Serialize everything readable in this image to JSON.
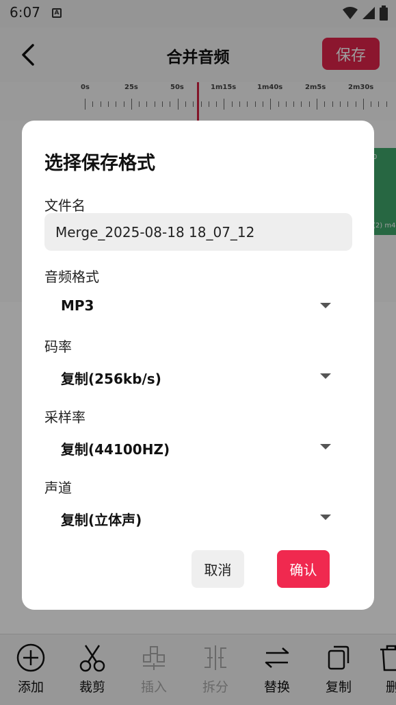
{
  "status_bar": {
    "time": "6:07",
    "notification_icon": "A"
  },
  "header": {
    "title": "合并音频",
    "save_label": "保存"
  },
  "timeline": {
    "ticks": [
      "0s",
      "25s",
      "50s",
      "1m15s",
      "1m40s",
      "2m5s",
      "2m30s"
    ]
  },
  "track": {
    "label_top": "0",
    "label_bottom": "(2) m4"
  },
  "dialog": {
    "title": "选择保存格式",
    "filename_label": "文件名",
    "filename_value": "Merge_2025-08-18 18_07_12",
    "format_label": "音频格式",
    "format_value": "MP3",
    "bitrate_label": "码率",
    "bitrate_value": "复制(256kb/s)",
    "samplerate_label": "采样率",
    "samplerate_value": "复制(44100HZ)",
    "channel_label": "声道",
    "channel_value": "复制(立体声)",
    "cancel_label": "取消",
    "confirm_label": "确认"
  },
  "toolbar": {
    "add": "添加",
    "cut": "裁剪",
    "insert": "插入",
    "split": "拆分",
    "replace": "替换",
    "copy": "复制",
    "delete": "删"
  },
  "colors": {
    "accent": "#f0294f",
    "save_button": "#e0254b",
    "track": "#3fa66b",
    "playhead": "#d0213f"
  }
}
